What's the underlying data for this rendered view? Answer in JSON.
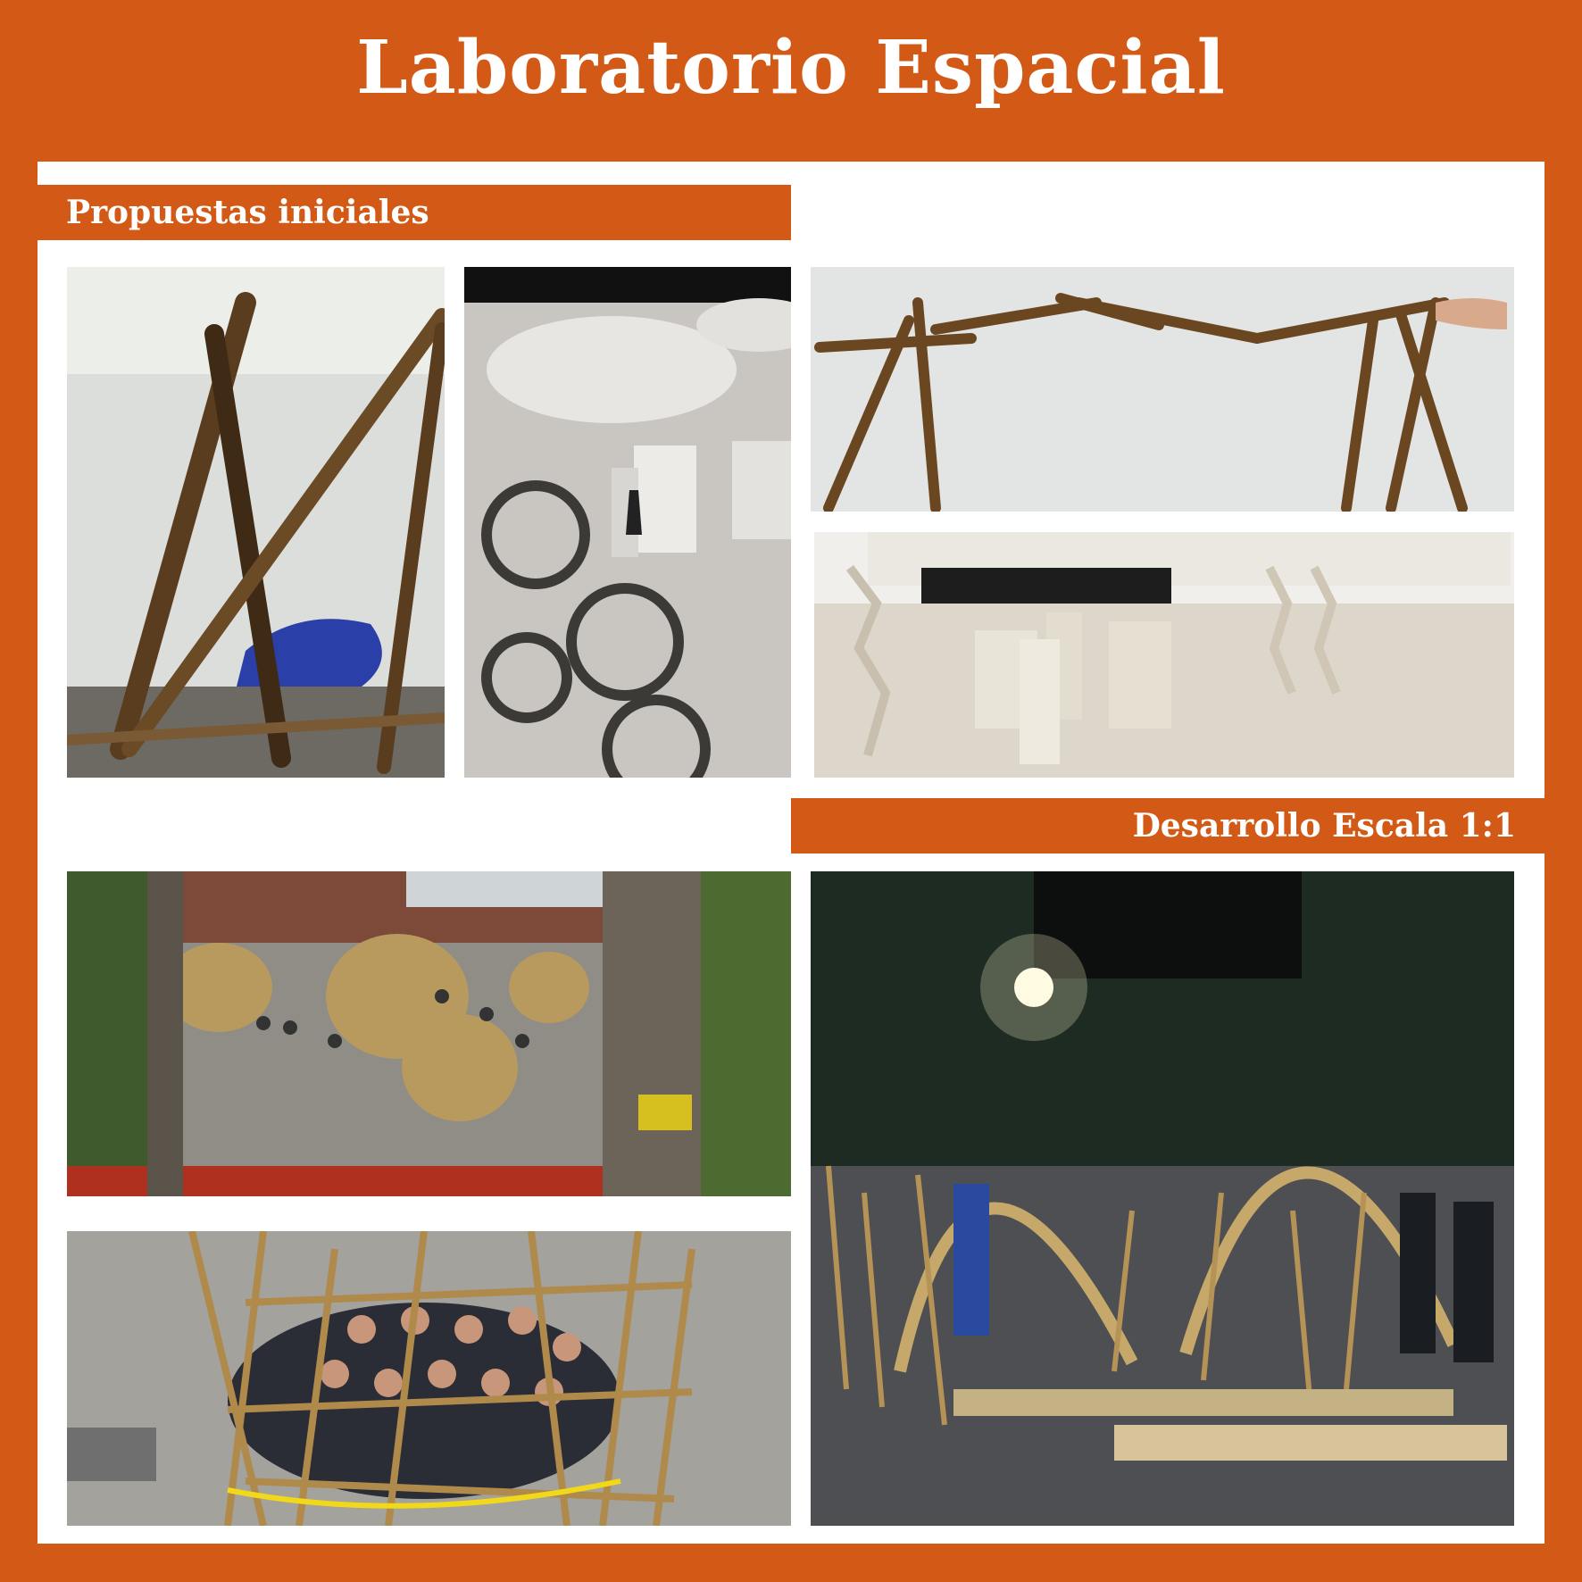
{
  "title": "Laboratorio Espacial",
  "sections": {
    "initial": "Propuestas iniciales",
    "development": "Desarrollo Escala 1:1"
  },
  "colors": {
    "accent": "#D35A16",
    "panel": "#FFFFFF",
    "text": "#FFFFFF"
  }
}
